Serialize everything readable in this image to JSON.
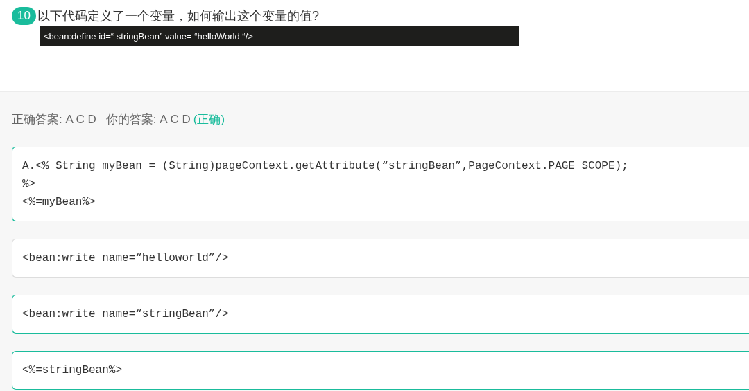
{
  "question": {
    "number": "10",
    "text": "以下代码定义了一个变量，如何输出这个变量的值?",
    "code": "<bean:define id=“ stringBean” value= “helloWorld “/>"
  },
  "result": {
    "correct_label": "正确答案: A C D",
    "your_label": "你的答案: A C D",
    "verdict": "(正确)"
  },
  "options": [
    {
      "text": "A.<% String myBean = (String)pageContext.getAttribute(“stringBean”,PageContext.PAGE_SCOPE);\n%>\n<%=myBean%>",
      "selected": true
    },
    {
      "text": "<bean:write name=“helloworld”/>",
      "selected": false
    },
    {
      "text": "<bean:write name=“stringBean”/>",
      "selected": true
    },
    {
      "text": "<%=stringBean%>",
      "selected": true
    }
  ]
}
